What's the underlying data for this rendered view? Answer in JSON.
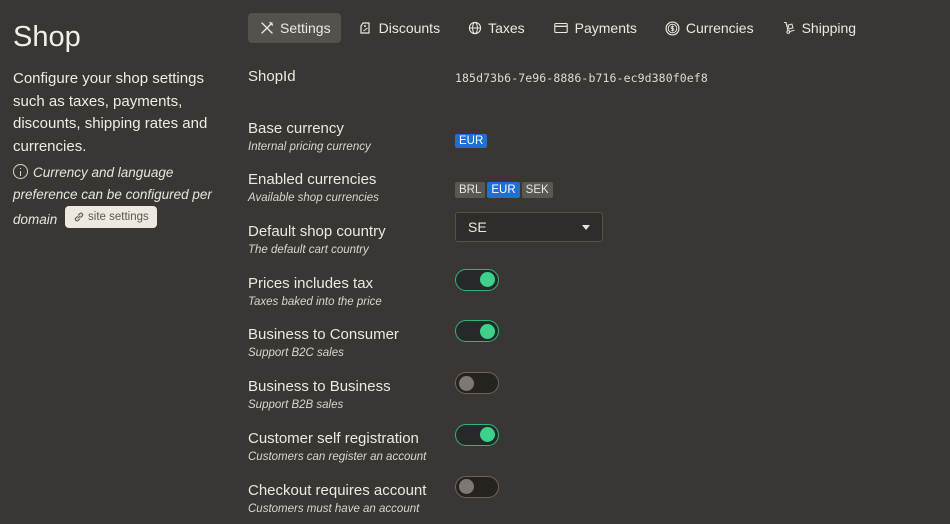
{
  "sidebar": {
    "title": "Shop",
    "description": "Configure your shop settings such as taxes, payments, discounts, shipping rates and currencies.",
    "note": "Currency and language preference can be configured per domain",
    "site_settings_label": "site settings"
  },
  "tabs": [
    {
      "label": "Settings",
      "icon": "wrench-screwdriver-icon",
      "active": true
    },
    {
      "label": "Discounts",
      "icon": "tag-icon",
      "active": false
    },
    {
      "label": "Taxes",
      "icon": "globe-icon",
      "active": false
    },
    {
      "label": "Payments",
      "icon": "credit-card-icon",
      "active": false
    },
    {
      "label": "Currencies",
      "icon": "coin-icon",
      "active": false
    },
    {
      "label": "Shipping",
      "icon": "hand-truck-icon",
      "active": false
    }
  ],
  "settings": {
    "shop_id": {
      "label": "ShopId",
      "value": "185d73b6-7e96-8886-b716-ec9d380f0ef8"
    },
    "base_currency": {
      "label": "Base currency",
      "sub": "Internal pricing currency",
      "value": "EUR"
    },
    "enabled_currencies": {
      "label": "Enabled currencies",
      "sub": "Available shop currencies",
      "values": [
        "BRL",
        "EUR",
        "SEK"
      ],
      "primary": "EUR"
    },
    "default_country": {
      "label": "Default shop country",
      "sub": "The default cart country",
      "value": "SE"
    },
    "prices_include_tax": {
      "label": "Prices includes tax",
      "sub": "Taxes baked into the price",
      "enabled": true
    },
    "b2c": {
      "label": "Business to Consumer",
      "sub": "Support B2C sales",
      "enabled": true
    },
    "b2b": {
      "label": "Business to Business",
      "sub": "Support B2B sales",
      "enabled": false
    },
    "self_registration": {
      "label": "Customer self registration",
      "sub": "Customers can register an account",
      "enabled": true
    },
    "checkout_requires_account": {
      "label": "Checkout requires account",
      "sub": "Customers must have an account",
      "enabled": false
    }
  },
  "colors": {
    "toggle_on": "#3ed18a",
    "badge_primary": "#1f6fd4",
    "background": "#3a3633"
  }
}
